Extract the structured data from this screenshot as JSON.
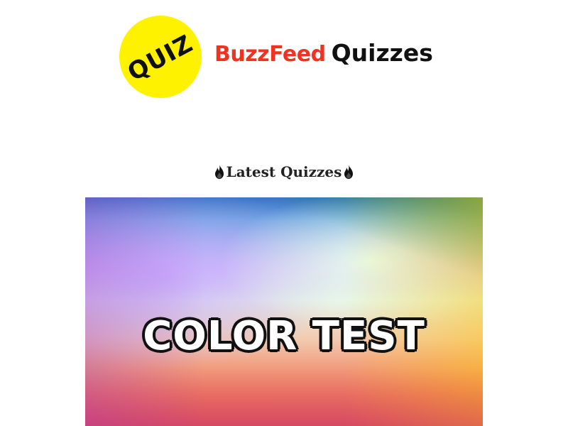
{
  "header": {
    "badge_text": "QUIZ",
    "brand_name": "BuzzFeed",
    "brand_suffix": "Quizzes",
    "badge_color": "#fff200",
    "brand_color": "#ee3322"
  },
  "section": {
    "heading": "Latest Quizzes",
    "icon": "fire-icon"
  },
  "quizzes": [
    {
      "title": "COLOR TEST"
    }
  ]
}
